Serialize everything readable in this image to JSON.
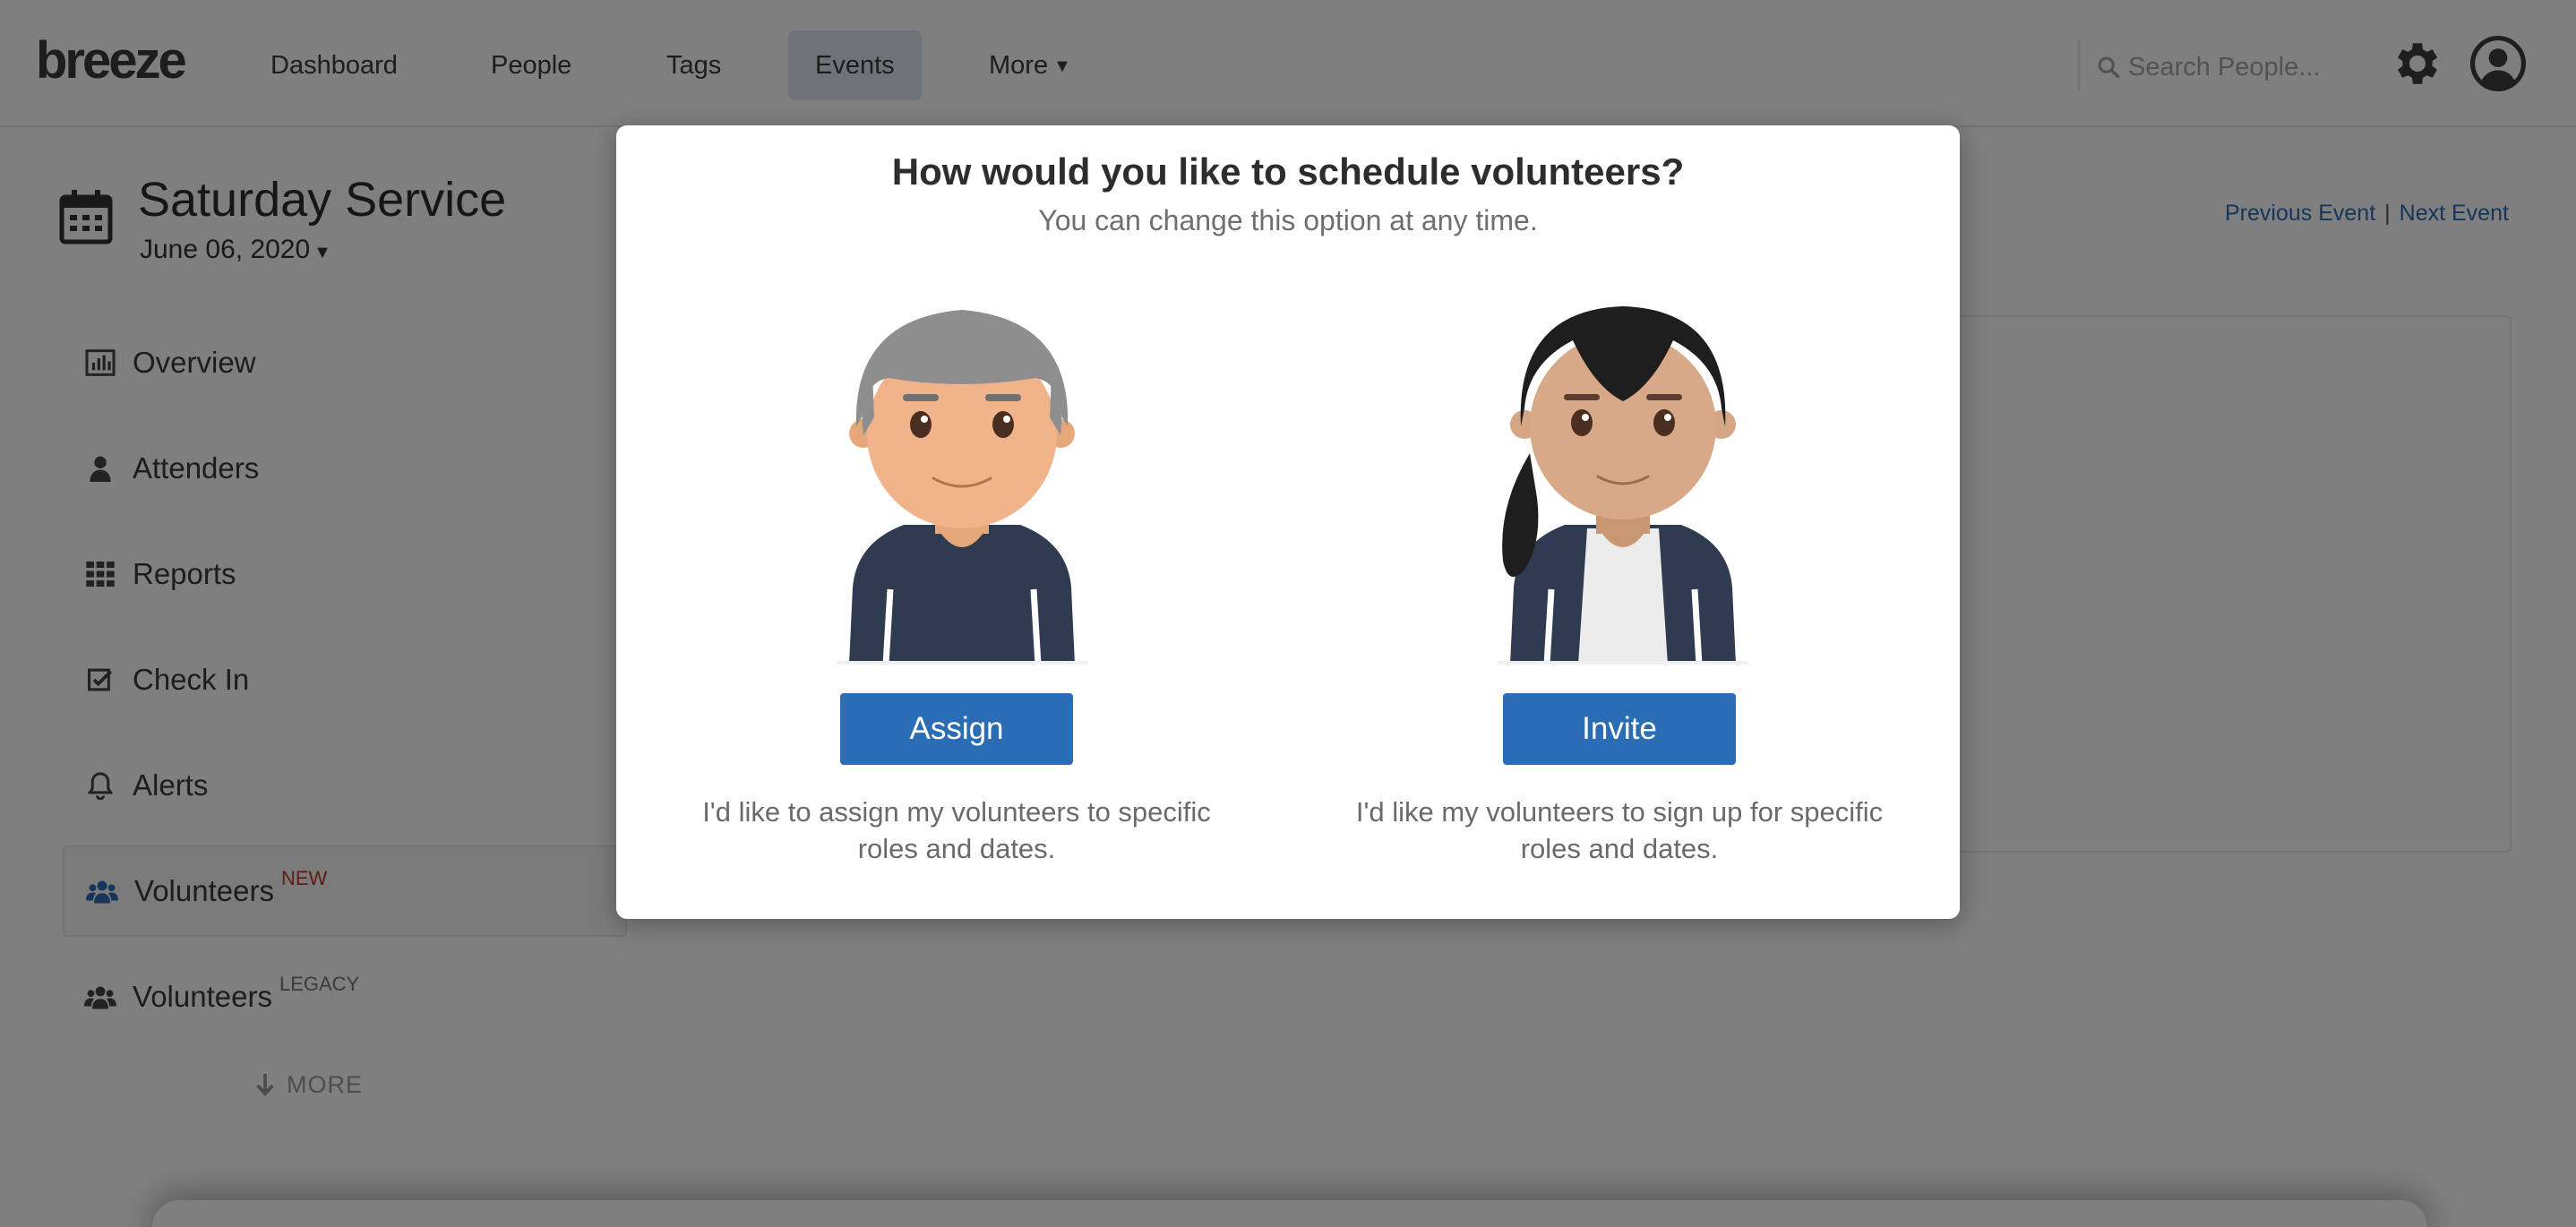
{
  "nav": {
    "logo": "breeze",
    "items": [
      {
        "label": "Dashboard",
        "active": false
      },
      {
        "label": "People",
        "active": false
      },
      {
        "label": "Tags",
        "active": false
      },
      {
        "label": "Events",
        "active": true
      },
      {
        "label": "More",
        "active": false
      }
    ],
    "search_placeholder": "Search People..."
  },
  "event": {
    "title": "Saturday Service",
    "date": "June 06, 2020",
    "prev_link": "Previous Event",
    "separator": "|",
    "next_link": "Next Event"
  },
  "sidebar": {
    "items": [
      {
        "label": "Overview",
        "icon": "bar-chart-icon"
      },
      {
        "label": "Attenders",
        "icon": "user-icon"
      },
      {
        "label": "Reports",
        "icon": "grid-icon"
      },
      {
        "label": "Check In",
        "icon": "checkbox-icon"
      },
      {
        "label": "Alerts",
        "icon": "bell-icon"
      },
      {
        "label": "Volunteers",
        "badge": "NEW",
        "icon": "users-icon",
        "active": true
      },
      {
        "label": "Volunteers",
        "badge": "LEGACY",
        "icon": "users-icon"
      }
    ],
    "more": "MORE"
  },
  "modal": {
    "title": "How would you like to schedule volunteers?",
    "subtitle": "You can change this option at any time.",
    "assign": {
      "button": "Assign",
      "description": "I'd like to assign my volunteers to specific roles and dates."
    },
    "invite": {
      "button": "Invite",
      "description": "I'd like my volunteers to sign up for specific roles and dates."
    }
  },
  "colors": {
    "primary": "#2b6db4",
    "badge_new": "#c0392b",
    "overlay": "rgba(0,0,0,0.5)",
    "active_nav": "#dde6ef"
  }
}
